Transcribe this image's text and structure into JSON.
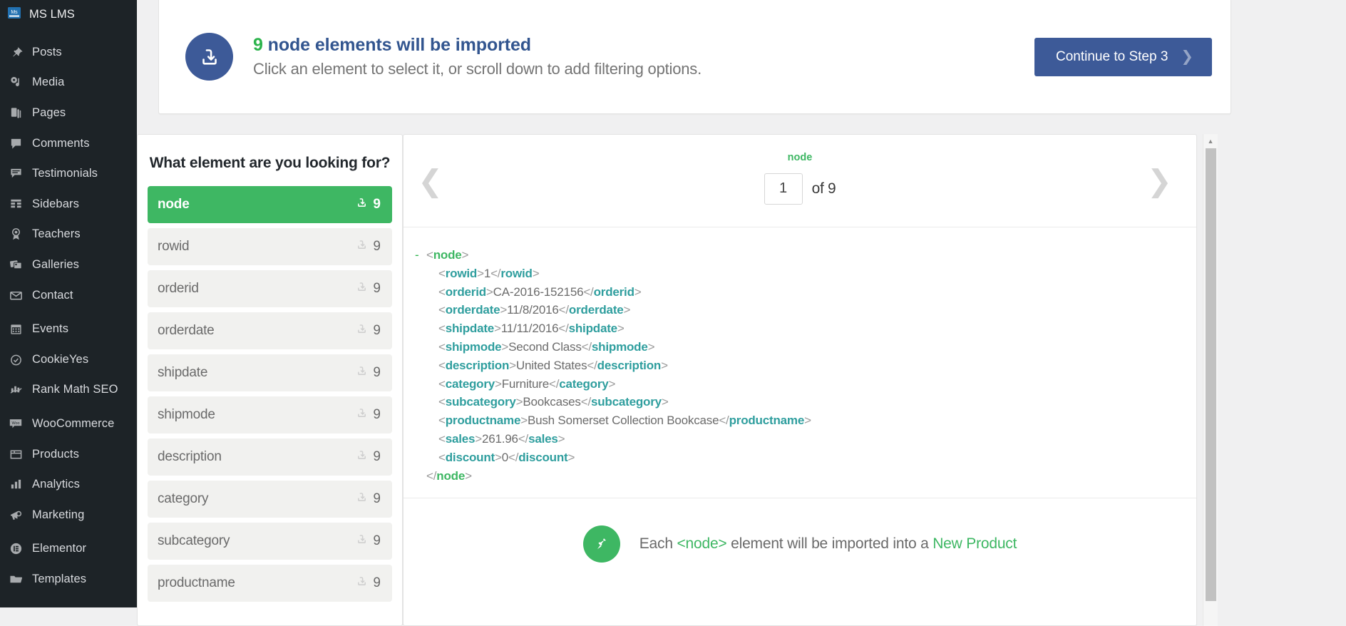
{
  "sidebar": {
    "brand": {
      "label": "MS LMS",
      "icon": "ms-lms-logo-icon"
    },
    "items": [
      {
        "label": "Posts",
        "icon": "pin-icon"
      },
      {
        "label": "Media",
        "icon": "media-icon"
      },
      {
        "label": "Pages",
        "icon": "pages-icon"
      },
      {
        "label": "Comments",
        "icon": "comment-icon"
      },
      {
        "label": "Testimonials",
        "icon": "testimonial-icon"
      },
      {
        "label": "Sidebars",
        "icon": "sidebars-grid-icon"
      },
      {
        "label": "Teachers",
        "icon": "award-icon"
      },
      {
        "label": "Galleries",
        "icon": "galleries-icon"
      },
      {
        "label": "Contact",
        "icon": "envelope-icon"
      },
      {
        "label": "Events",
        "icon": "calendar-icon"
      },
      {
        "label": "CookieYes",
        "icon": "cookie-icon"
      },
      {
        "label": "Rank Math SEO",
        "icon": "rankmath-icon"
      },
      {
        "label": "WooCommerce",
        "icon": "woo-icon"
      },
      {
        "label": "Products",
        "icon": "products-box-icon"
      },
      {
        "label": "Analytics",
        "icon": "bar-chart-icon"
      },
      {
        "label": "Marketing",
        "icon": "megaphone-icon"
      },
      {
        "label": "Elementor",
        "icon": "elementor-icon"
      },
      {
        "label": "Templates",
        "icon": "folder-icon"
      }
    ]
  },
  "header": {
    "icon": "import-download-icon",
    "count": "9",
    "title_rest": " node elements will be imported",
    "subtitle": "Click an element to select it, or scroll down to add filtering options.",
    "continue_label": "Continue to Step 3",
    "continue_chevron": "chevron-right-icon",
    "accent_blue": "#3d5a98",
    "accent_green": "#2bb34b"
  },
  "picker": {
    "title": "What element are you looking for?",
    "items": [
      {
        "label": "node",
        "count": "9",
        "selected": true
      },
      {
        "label": "rowid",
        "count": "9",
        "selected": false
      },
      {
        "label": "orderid",
        "count": "9",
        "selected": false
      },
      {
        "label": "orderdate",
        "count": "9",
        "selected": false
      },
      {
        "label": "shipdate",
        "count": "9",
        "selected": false
      },
      {
        "label": "shipmode",
        "count": "9",
        "selected": false
      },
      {
        "label": "description",
        "count": "9",
        "selected": false
      },
      {
        "label": "category",
        "count": "9",
        "selected": false
      },
      {
        "label": "subcategory",
        "count": "9",
        "selected": false
      },
      {
        "label": "productname",
        "count": "9",
        "selected": false
      }
    ]
  },
  "preview": {
    "node_label": "node",
    "page_value": "1",
    "page_total": "of 9",
    "prev_icon": "chevron-left-icon",
    "next_icon": "chevron-right-icon",
    "root_tag": "node",
    "fields": [
      {
        "tag": "rowid",
        "value": "1"
      },
      {
        "tag": "orderid",
        "value": "CA-2016-152156"
      },
      {
        "tag": "orderdate",
        "value": "11/8/2016"
      },
      {
        "tag": "shipdate",
        "value": "11/11/2016"
      },
      {
        "tag": "shipmode",
        "value": "Second Class"
      },
      {
        "tag": "description",
        "value": "United States"
      },
      {
        "tag": "category",
        "value": "Furniture"
      },
      {
        "tag": "subcategory",
        "value": "Bookcases"
      },
      {
        "tag": "productname",
        "value": "Bush Somerset Collection Bookcase"
      },
      {
        "tag": "sales",
        "value": "261.96"
      },
      {
        "tag": "discount",
        "value": "0"
      }
    ]
  },
  "note": {
    "icon": "pushpin-icon",
    "prefix": "Each ",
    "node_tag": "<node>",
    "middle": " element will be imported into a ",
    "target": "New Product"
  },
  "scrollbar": {
    "up_icon": "scroll-up-arrow-icon"
  }
}
